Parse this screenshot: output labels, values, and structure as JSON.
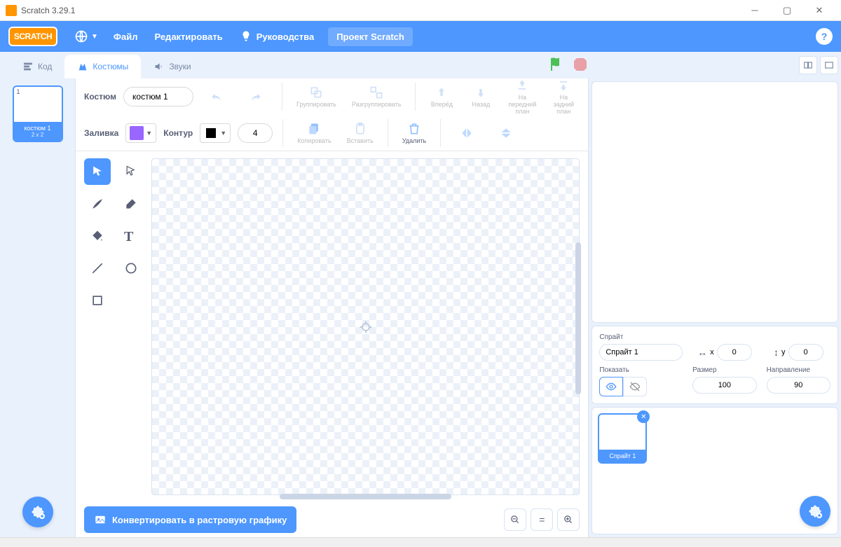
{
  "window": {
    "title": "Scratch 3.29.1"
  },
  "menubar": {
    "logo": "SCRATCH",
    "file": "Файл",
    "edit": "Редактировать",
    "tutorials": "Руководства",
    "project_name": "Проект Scratch"
  },
  "tabs": {
    "code": "Код",
    "costumes": "Костюмы",
    "sounds": "Звуки"
  },
  "costume_list": {
    "item1": {
      "num": "1",
      "name": "костюм 1",
      "dim": "2 x 2"
    }
  },
  "editor": {
    "costume_label": "Костюм",
    "costume_name": "костюм 1",
    "group": "Группировать",
    "ungroup": "Разгруппировать",
    "forward": "Вперёд",
    "backward": "Назад",
    "front": "На\nпередний\nплан",
    "back": "На\nзадний\nплан",
    "fill_label": "Заливка",
    "fill_color": "#9966ff",
    "outline_label": "Контур",
    "outline_color": "#000000",
    "outline_width": "4",
    "copy": "Копировать",
    "paste": "Вставить",
    "delete": "Удалить",
    "convert": "Конвертировать в растровую графику"
  },
  "sprite_panel": {
    "sprite_label": "Спрайт",
    "sprite_name": "Спрайт 1",
    "x_label": "x",
    "x_value": "0",
    "y_label": "y",
    "y_value": "0",
    "show_label": "Показать",
    "size_label": "Размер",
    "size_value": "100",
    "direction_label": "Направление",
    "direction_value": "90",
    "tile_name": "Спрайт 1"
  }
}
